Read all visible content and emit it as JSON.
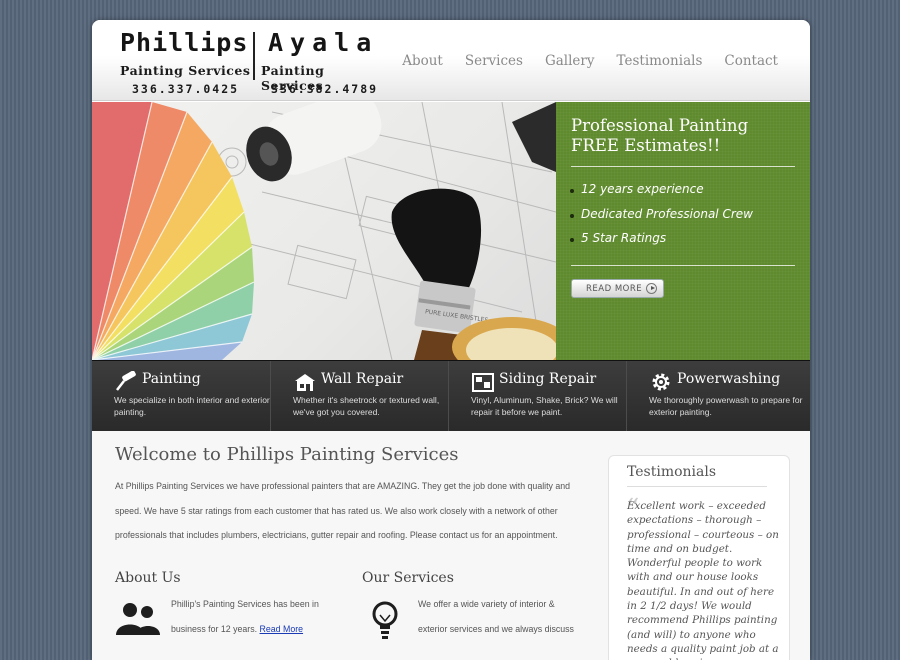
{
  "logo": {
    "name_left": "Phillips",
    "name_right": "Ayala",
    "sub_left": "Painting Services",
    "sub_right": "Painting Services",
    "phone_left": "336.337.0425",
    "phone_right": "336.382.4789"
  },
  "nav": {
    "items": [
      "About",
      "Services",
      "Gallery",
      "Testimonials",
      "Contact"
    ]
  },
  "hero": {
    "title_line1": "Professional Painting",
    "title_line2": "FREE Estimates!!",
    "bullets": [
      "12 years experience",
      "Dedicated Professional Crew",
      "5 Star Ratings"
    ],
    "read_more_label": "READ MORE",
    "brush_text": "PURE LUXE BRISTLES"
  },
  "services": [
    {
      "title": "Painting",
      "icon": "paint-roller-icon",
      "desc": "We specialize in both interior and exterior painting."
    },
    {
      "title": "Wall Repair",
      "icon": "house-icon",
      "desc": "Whether it's sheetrock or textured wall, we've got you covered."
    },
    {
      "title": "Siding Repair",
      "icon": "siding-icon",
      "desc": "Vinyl, Aluminum, Shake, Brick? We will repair it before we paint."
    },
    {
      "title": "Powerwashing",
      "icon": "gear-icon",
      "desc": "We thoroughly powerwash to prepare for exterior painting."
    }
  ],
  "welcome": {
    "title": "Welcome to Phillips Painting Services",
    "text": "At Phillips Painting Services we have professional painters that are AMAZING. They get the job done with quality and speed. We have 5 star ratings from each customer that has rated us. We also work closely with a network of other professionals that includes plumbers, electricians, gutter repair and roofing. Please contact us for an appointment."
  },
  "about": {
    "title": "About Us",
    "text": "Phillip's Painting Services has been in business for 12 years.",
    "link": "Read More",
    "icon": "people-icon"
  },
  "our_services": {
    "title": "Our Services",
    "text": "We offer a wide variety of interior & exterior services and we always discuss",
    "icon": "lightbulb-icon"
  },
  "testimonials": {
    "title": "Testimonials",
    "quote": "Excellent work – exceeded expectations – thorough – professional – courteous – on time and on budget. Wonderful people to work with and our house looks beautiful. In and out of here in 2 1/2 days! We would recommend Phillips painting (and will) to anyone who needs a quality paint job at a reasonable price."
  },
  "colors": {
    "background": "#56667a",
    "hero_green": "#5f8a2e",
    "strip_dark": "#333333",
    "link_blue": "#1a3bb5"
  }
}
